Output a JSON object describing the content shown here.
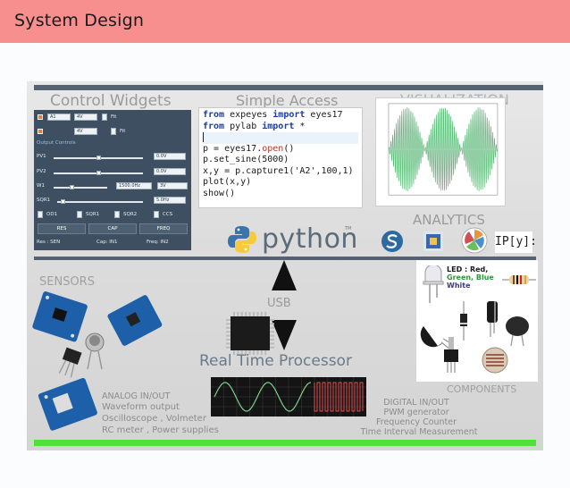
{
  "header": {
    "title": "System Design"
  },
  "poster": {
    "titles": {
      "control_widgets": "Control Widgets",
      "simple_access": "Simple Access",
      "visualization": "VISUALIZATION",
      "analytics": "ANALYTICS",
      "sensors": "SENSORS",
      "components": "COMPONENTS",
      "processor": "Real Time Processor",
      "usb": "USB"
    },
    "control_widgets": {
      "row1_sel1": "A1",
      "row1_sel2": "4V",
      "row1_fit": "Fit",
      "row2_sel2": "4V",
      "row2_fit": "Fit",
      "output_controls": "Output Controls",
      "pv1": "PV1",
      "pv1_val": "0.0V",
      "pv2": "PV2",
      "pv2_val": "0.0V",
      "w1": "W1",
      "w1_val": "1500.0Hz",
      "w1_sel": "3V",
      "sqr1": "SQR1",
      "sqr1_val": "5.0Hz",
      "od1": "OD1",
      "sqr1_chk": "SQR1",
      "sqr2_chk": "SQR2",
      "ccs": "CCS",
      "btn_res": "RES",
      "btn_cap": "CAP",
      "btn_freq": "FREQ",
      "res_sen": "Res : SEN",
      "cap_in1": "Cap: IN1",
      "freq_in2": "Freq: IN2"
    },
    "code_lines": [
      {
        "kw1": "from",
        "mid": " expeyes ",
        "kw2": "import",
        "tail": " eyes17"
      },
      {
        "kw1": "from",
        "mid": " pylab ",
        "kw2": "import",
        "tail": " *"
      },
      {
        "kw1": "",
        "mid": "",
        "kw2": "",
        "tail": ""
      },
      {
        "kw1": "",
        "mid": "p = eyes17.",
        "kw2": "open",
        "tail": "()"
      },
      {
        "kw1": "",
        "mid": "p.set_sine(5000)",
        "kw2": "",
        "tail": ""
      },
      {
        "kw1": "",
        "mid": "x,y = p.capture1('A2',100,1)",
        "kw2": "",
        "tail": ""
      },
      {
        "kw1": "",
        "mid": "plot(x,y)",
        "kw2": "",
        "tail": ""
      },
      {
        "kw1": "",
        "mid": "show()",
        "kw2": "",
        "tail": ""
      }
    ],
    "python_logo_text": "python",
    "python_tm": "TM",
    "ipython_label": "IP[y]:",
    "led_text": {
      "l1": "LED : Red,",
      "l2": "Green, Blue",
      "l3": "White"
    },
    "analog": {
      "title": "ANALOG  IN/OUT",
      "line1": "Waveform output",
      "line2": "Oscilloscope , Volmeter",
      "line3": "RC meter , Power supplies"
    },
    "digital": {
      "title": "DIGITAL  IN/OUT",
      "line1": "PWM generator",
      "line2": "Frequency Counter",
      "line3": "Time Interval Measurement"
    }
  },
  "colors": {
    "header_bg": "#f78f8f",
    "bar_dark": "#556274",
    "bar_green": "#4fe13a",
    "panel": "#3d4f60",
    "plot_line": "#5fb87a"
  },
  "icons": [
    "python-logo-icon",
    "scipy-icon",
    "numpy-icon",
    "matplotlib-icon",
    "arrow-up-icon",
    "arrow-down-icon",
    "microchip-icon",
    "oscilloscope-icon",
    "sensor-board-icon",
    "led-icon",
    "resistor-icon",
    "capacitor-icon",
    "diode-icon",
    "buzzer-icon",
    "potentiometer-icon",
    "ldr-icon",
    "transistor-icon"
  ]
}
